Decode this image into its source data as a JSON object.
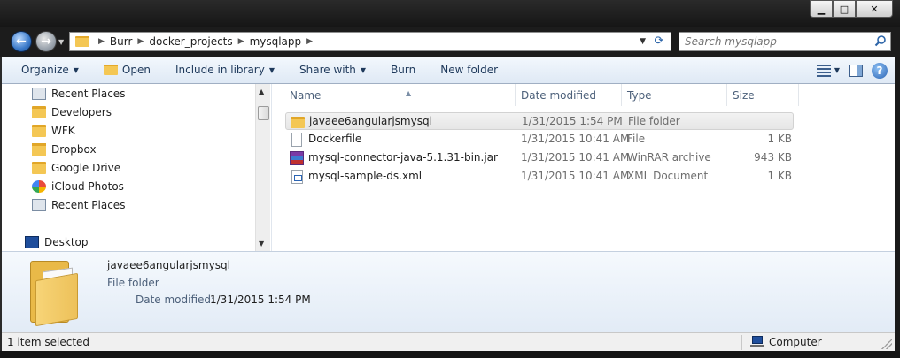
{
  "window": {
    "controls": {
      "minimize": "▁",
      "maximize": "□",
      "close": "✕"
    }
  },
  "address": {
    "crumbs": [
      "Burr",
      "docker_projects",
      "mysqlapp"
    ],
    "separator": "▶",
    "refresh_glyph": "⟳",
    "dropdown_glyph": "▼"
  },
  "nav_buttons": {
    "back": "←",
    "forward": "→",
    "dropdown": "▼"
  },
  "search": {
    "placeholder": "Search mysqlapp"
  },
  "toolbar": {
    "organize": "Organize",
    "open": "Open",
    "include_in_library": "Include in library",
    "share_with": "Share with",
    "burn": "Burn",
    "new_folder": "New folder",
    "help": "?",
    "arrow": "▼"
  },
  "navigation_pane": {
    "items": [
      {
        "label": "Recent Places",
        "icon": "recent-places-icon"
      },
      {
        "label": "Developers",
        "icon": "folder-icon"
      },
      {
        "label": "WFK",
        "icon": "folder-icon"
      },
      {
        "label": "Dropbox",
        "icon": "dropbox-icon"
      },
      {
        "label": "Google Drive",
        "icon": "google-drive-icon"
      },
      {
        "label": "iCloud Photos",
        "icon": "icloud-photos-icon"
      },
      {
        "label": "Recent Places",
        "icon": "recent-places-icon"
      },
      {
        "label": "Desktop",
        "icon": "desktop-icon"
      }
    ],
    "scroll_up": "▲",
    "scroll_down": "▼"
  },
  "file_list": {
    "columns": {
      "name": "Name",
      "date_modified": "Date modified",
      "type": "Type",
      "size": "Size"
    },
    "sort_indicator": "▲",
    "rows": [
      {
        "name": "javaee6angularjsmysql",
        "date": "1/31/2015 1:54 PM",
        "type": "File folder",
        "size": "",
        "icon": "folder-icon",
        "selected": true
      },
      {
        "name": "Dockerfile",
        "date": "1/31/2015 10:41 AM",
        "type": "File",
        "size": "1 KB",
        "icon": "file-icon",
        "selected": false
      },
      {
        "name": "mysql-connector-java-5.1.31-bin.jar",
        "date": "1/31/2015 10:41 AM",
        "type": "WinRAR archive",
        "size": "943 KB",
        "icon": "winrar-archive-icon",
        "selected": false
      },
      {
        "name": "mysql-sample-ds.xml",
        "date": "1/31/2015 10:41 AM",
        "type": "XML Document",
        "size": "1 KB",
        "icon": "xml-document-icon",
        "selected": false
      }
    ]
  },
  "details_pane": {
    "name": "javaee6angularjsmysql",
    "type": "File folder",
    "date_label": "Date modified:",
    "date_value": "1/31/2015 1:54 PM"
  },
  "status_bar": {
    "selection": "1 item selected",
    "location": "Computer"
  },
  "colors": {
    "command_bar": "#dfe9f5",
    "details_pane": "#e2ebf6",
    "folder": "#f4c754",
    "accent": "#2a64b4"
  }
}
